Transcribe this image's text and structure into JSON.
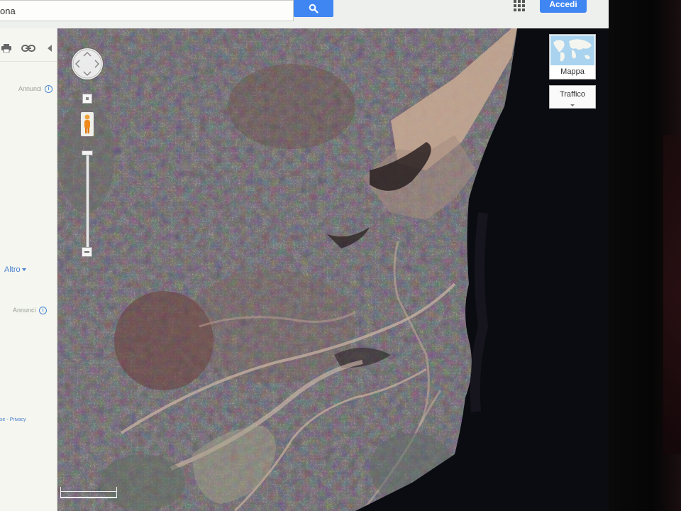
{
  "search": {
    "value": "ona"
  },
  "header": {
    "signin_label": "Accedi"
  },
  "sidebar": {
    "ads_label_1": "Annunci",
    "ads_label_2": "Annunci",
    "more_label": "Altro",
    "footer": "se - Privacy"
  },
  "map": {
    "map_type_label": "Mappa",
    "traffic_label": "Traffico",
    "view": "satellite"
  },
  "colors": {
    "accent_blue": "#3f86f3",
    "link_blue": "#4a7fcf"
  }
}
